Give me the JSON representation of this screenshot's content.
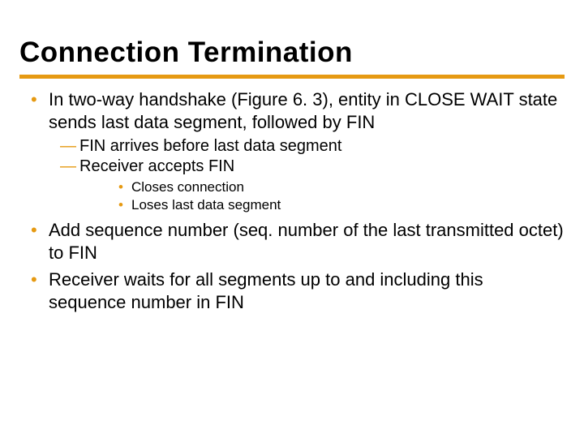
{
  "accent": "#e69a12",
  "title": "Connection Termination",
  "bullets": [
    {
      "text": "In two-way handshake (Figure 6. 3), entity in CLOSE WAIT state sends last data segment, followed by FIN",
      "dash": [
        {
          "text": "FIN arrives before last data segment"
        },
        {
          "text": "Receiver accepts FIN",
          "sub": [
            {
              "text": "Closes connection"
            },
            {
              "text": "Loses last data segment"
            }
          ]
        }
      ]
    },
    {
      "text": "Add sequence number (seq. number of the last transmitted octet) to FIN"
    },
    {
      "text": "Receiver waits for all segments up to and including this sequence number in FIN"
    }
  ]
}
